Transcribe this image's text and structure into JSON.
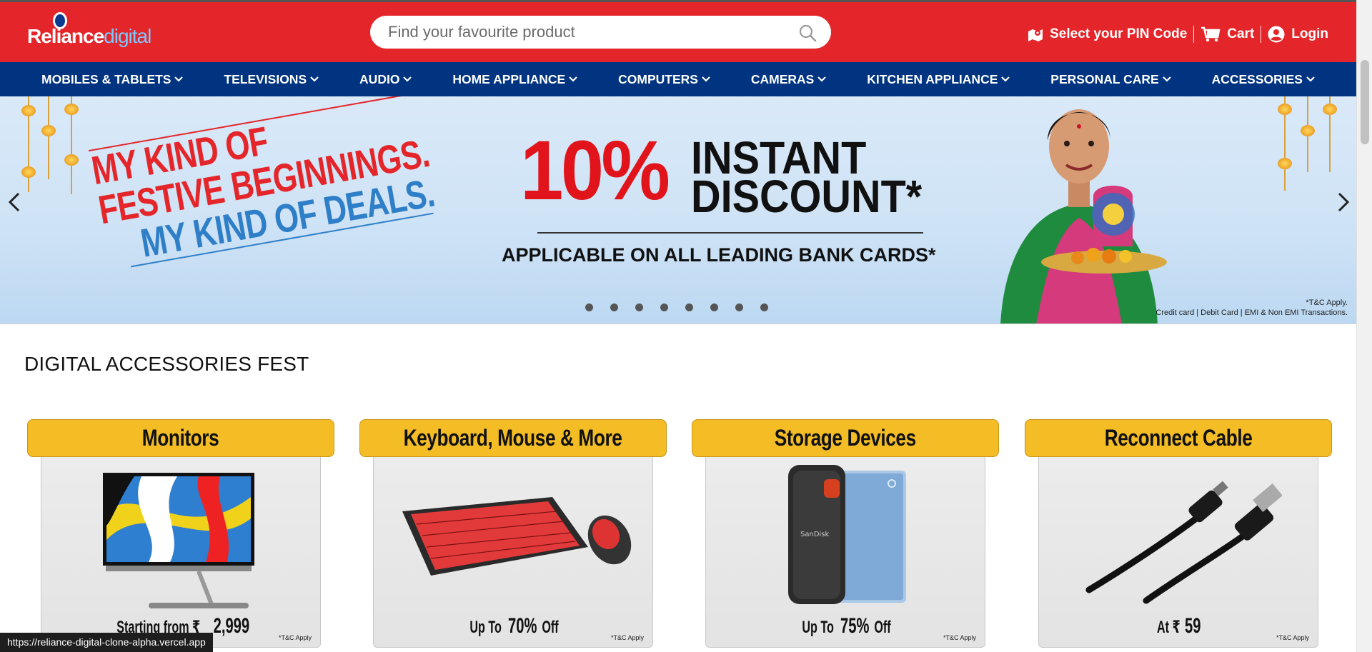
{
  "header": {
    "logo_text_main": "Reliance",
    "logo_text_accent": "digital",
    "search_placeholder": "Find your favourite product",
    "pin_label": "Select your PIN Code",
    "cart_label": "Cart",
    "login_label": "Login",
    "brand_color": "#e42529"
  },
  "nav": {
    "color": "#003380",
    "items": [
      {
        "label": "MOBILES & TABLETS"
      },
      {
        "label": "TELEVISIONS"
      },
      {
        "label": "AUDIO"
      },
      {
        "label": "HOME APPLIANCE"
      },
      {
        "label": "COMPUTERS"
      },
      {
        "label": "CAMERAS"
      },
      {
        "label": "KITCHEN APPLIANCE"
      },
      {
        "label": "PERSONAL CARE"
      },
      {
        "label": "ACCESSORIES"
      }
    ]
  },
  "banner": {
    "slogan_1": "MY KIND OF",
    "slogan_2": "FESTIVE BEGINNINGS.",
    "slogan_3": "MY KIND OF DEALS.",
    "discount_pct": "10%",
    "discount_l1": "INSTANT",
    "discount_l2": "DISCOUNT*",
    "discount_sub": "APPLICABLE ON ALL LEADING BANK CARDS*",
    "tc_1": "*T&C Apply.",
    "tc_2": "Credit card | Debit Card | EMI & Non EMI Transactions.",
    "slide_count": 8,
    "active_slide": 1
  },
  "section": {
    "title": "DIGITAL ACCESSORIES FEST",
    "cards": [
      {
        "title": "Monitors",
        "offer_prefix": "Starting from ₹",
        "offer_value": "2,999",
        "offer_suffix": "",
        "tc": "*T&C Apply"
      },
      {
        "title": "Keyboard, Mouse & More",
        "offer_prefix": "Up To ",
        "offer_value": "70%",
        "offer_suffix": " Off",
        "tc": "*T&C Apply"
      },
      {
        "title": "Storage Devices",
        "offer_prefix": "Up To ",
        "offer_value": "75%",
        "offer_suffix": " Off",
        "tc": "*T&C Apply"
      },
      {
        "title": "Reconnect Cable",
        "offer_prefix": "At ₹",
        "offer_value": "59",
        "offer_suffix": "",
        "tc": "*T&C Apply"
      }
    ]
  },
  "status_url": "https://reliance-digital-clone-alpha.vercel.app"
}
